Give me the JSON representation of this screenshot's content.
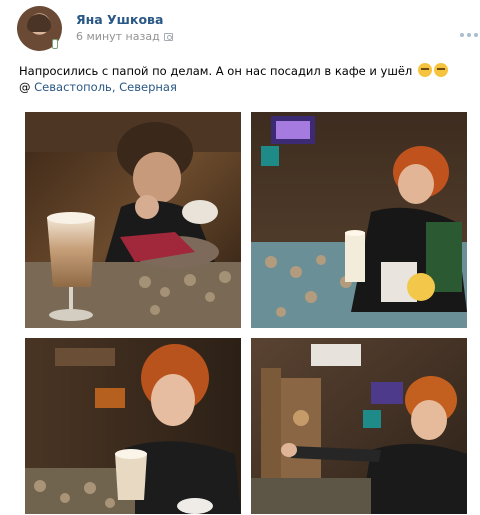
{
  "post": {
    "author": "Яна Ушкова",
    "timestamp": "6 минут назад",
    "text": "Напросились с папой по делам. А он нас посадил в кафе и ушёл",
    "emojis": [
      "smirking-face",
      "smirking-face"
    ],
    "location_prefix": "@",
    "location": "Севастополь, Северная",
    "photos": [
      {
        "name": "photo-girl-eating-dessert"
      },
      {
        "name": "photo-girl-cafe-table"
      },
      {
        "name": "photo-girl-latte-glass"
      },
      {
        "name": "photo-girl-reaching-table"
      }
    ]
  },
  "colors": {
    "author_link": "#2a5885",
    "timestamp": "#939393",
    "more_dots": "#a9bdd0",
    "emoji": "#f6c33e"
  },
  "icons": [
    "mobile-badge-icon",
    "camera-icon",
    "more-options-icon"
  ]
}
